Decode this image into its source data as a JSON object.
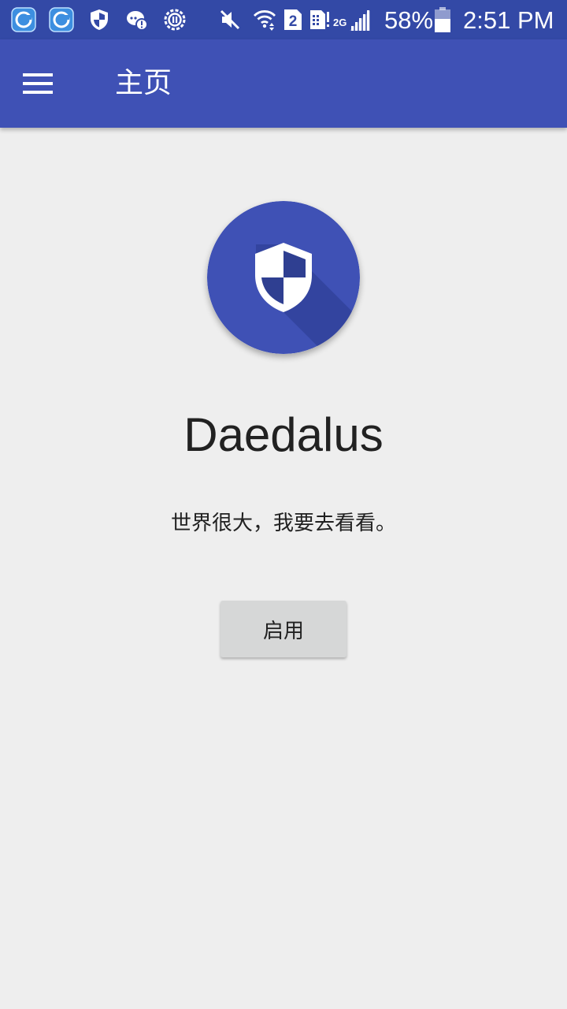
{
  "status_bar": {
    "battery_percent": "58%",
    "time": "2:51 PM",
    "sim_label": "2",
    "network_label": "2G",
    "icons": [
      "app-notification-icon",
      "app-notification-icon",
      "shield-icon",
      "chat-alert-icon",
      "settings-notification-icon",
      "mute-icon",
      "wifi-icon",
      "sim-icon",
      "data-icon",
      "signal-icon",
      "battery-icon"
    ],
    "battery_level": 0.58
  },
  "app_bar": {
    "title": "主页",
    "menu_icon": "hamburger-menu-icon",
    "color": "#3f51b5"
  },
  "main": {
    "logo_icon": "shield-icon",
    "app_name": "Daedalus",
    "slogan": "世界很大，我要去看看。",
    "enable_button_label": "启用"
  },
  "colors": {
    "primary": "#3f51b5",
    "primary_dark": "#3349a6",
    "background": "#eeeeee",
    "button": "#d6d7d7",
    "text": "#212121"
  }
}
